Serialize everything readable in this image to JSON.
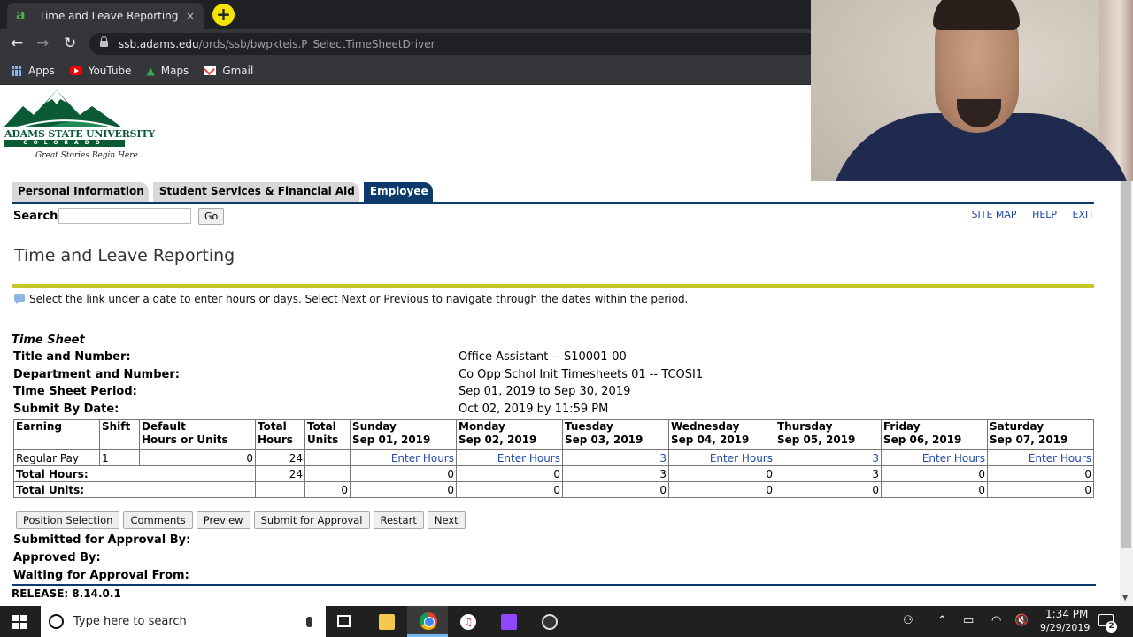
{
  "browser": {
    "tab_title": "Time and Leave Reporting",
    "tab_favicon": "a",
    "tab_close": "×",
    "new_tab": "+",
    "url_host": "ssb.adams.edu",
    "url_path": "/ords/ssb/bwpkteis.P_SelectTimeSheetDriver",
    "back": "←",
    "forward": "→",
    "reload": "↻",
    "bookmarks": [
      {
        "label": "Apps",
        "icon": "apps-icon"
      },
      {
        "label": "YouTube",
        "icon": "youtube-icon"
      },
      {
        "label": "Maps",
        "icon": "maps-icon"
      },
      {
        "label": "Gmail",
        "icon": "gmail-icon"
      }
    ],
    "maps_glyph": "▲"
  },
  "logo": {
    "university": "ADAMS STATE UNIVERSITY",
    "state": "COLORADO",
    "tagline": "Great Stories Begin Here",
    "colors": {
      "green": "#0b5a36",
      "mountain_green": "#1f8a57"
    }
  },
  "nav": {
    "tabs": [
      "Personal Information",
      "Student Services & Financial Aid",
      "Employee"
    ],
    "active_tab": "Employee",
    "accent": "#0c3b6b"
  },
  "search": {
    "label": "Search",
    "value": "",
    "button": "Go"
  },
  "utility_links": [
    "SITE MAP",
    "HELP",
    "EXIT"
  ],
  "page": {
    "title": "Time and Leave Reporting",
    "info": "Select the link under a date to enter hours or days. Select Next or Previous to navigate through the dates within the period.",
    "rule_color": "#c6c62a"
  },
  "timesheet": {
    "heading": "Time Sheet",
    "details": [
      {
        "label": "Title and Number:",
        "value": "Office Assistant -- S10001-00"
      },
      {
        "label": "Department and Number:",
        "value": "Co Opp Schol Init Timesheets 01 -- TCOSI1"
      },
      {
        "label": "Time Sheet Period:",
        "value": "Sep 01, 2019 to Sep 30, 2019"
      },
      {
        "label": "Submit By Date:",
        "value": "Oct 02, 2019 by 11:59 PM"
      }
    ],
    "columns": {
      "earning": "Earning",
      "shift": "Shift",
      "default_1": "Default",
      "default_2": "Hours or Units",
      "total_hours_1": "Total",
      "total_hours_2": "Hours",
      "total_units_1": "Total",
      "total_units_2": "Units",
      "days": [
        {
          "day": "Sunday",
          "date": "Sep 01, 2019"
        },
        {
          "day": "Monday",
          "date": "Sep 02, 2019"
        },
        {
          "day": "Tuesday",
          "date": "Sep 03, 2019"
        },
        {
          "day": "Wednesday",
          "date": "Sep 04, 2019"
        },
        {
          "day": "Thursday",
          "date": "Sep 05, 2019"
        },
        {
          "day": "Friday",
          "date": "Sep 06, 2019"
        },
        {
          "day": "Saturday",
          "date": "Sep 07, 2019"
        }
      ]
    },
    "regular_row": {
      "earning": "Regular Pay",
      "shift": "1",
      "default": "0",
      "total_hours": "24",
      "total_units": "",
      "cells": [
        "Enter Hours",
        "Enter Hours",
        "3",
        "Enter Hours",
        "3",
        "Enter Hours",
        "Enter Hours"
      ]
    },
    "total_hours_row": {
      "label": "Total Hours:",
      "total": "24",
      "cells": [
        "0",
        "0",
        "3",
        "0",
        "3",
        "0",
        "0"
      ]
    },
    "total_units_row": {
      "label": "Total Units:",
      "total": "0",
      "cells": [
        "0",
        "0",
        "0",
        "0",
        "0",
        "0",
        "0"
      ]
    },
    "buttons": [
      "Position Selection",
      "Comments",
      "Preview",
      "Submit for Approval",
      "Restart",
      "Next"
    ],
    "approval": [
      {
        "label": "Submitted for Approval By:"
      },
      {
        "label": "Approved By:"
      },
      {
        "label": "Waiting for Approval From:"
      }
    ]
  },
  "release": "RELEASE: 8.14.0.1",
  "taskbar": {
    "search_placeholder": "Type here to search",
    "itunes_glyph": "♫",
    "time": "1:34 PM",
    "date": "9/29/2019",
    "notification_count": "2",
    "tray": {
      "people": "⚇",
      "chevron": "⌃",
      "battery": "▭",
      "wifi": "◠",
      "volume": "🔇"
    }
  }
}
